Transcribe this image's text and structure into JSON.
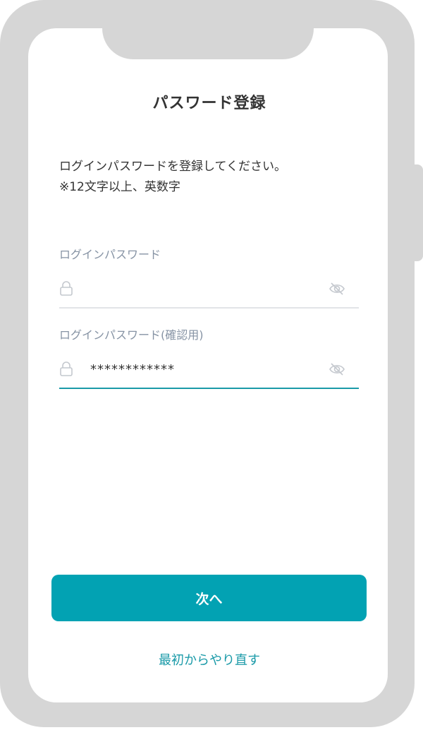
{
  "header": {
    "title": "パスワード登録"
  },
  "instructions": {
    "line1": "ログインパスワードを登録してください。",
    "line2": "※12文字以上、英数字"
  },
  "password_field": {
    "label": "ログインパスワード",
    "value": "",
    "lock_icon": "lock-icon",
    "toggle_icon": "eye-off-icon"
  },
  "confirm_field": {
    "label": "ログインパスワード(確認用)",
    "value": "************",
    "lock_icon": "lock-icon",
    "toggle_icon": "eye-off-icon"
  },
  "actions": {
    "next_label": "次へ",
    "restart_label": "最初からやり直す"
  },
  "colors": {
    "accent": "#02a2b3",
    "link": "#1a9aa8",
    "label": "#8693a4",
    "frame": "#d6d6d6"
  }
}
